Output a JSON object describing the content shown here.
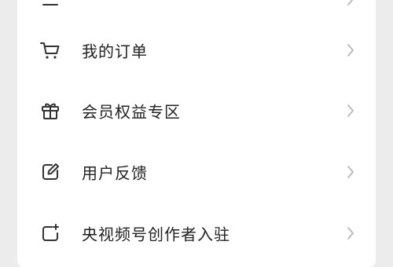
{
  "menu": {
    "items": [
      {
        "label": "",
        "icon": "partial-icon"
      },
      {
        "label": "我的订单",
        "icon": "cart-icon"
      },
      {
        "label": "会员权益专区",
        "icon": "gift-icon"
      },
      {
        "label": "用户反馈",
        "icon": "edit-icon"
      },
      {
        "label": "央视频号创作者入驻",
        "icon": "creator-icon"
      }
    ]
  },
  "colors": {
    "icon": "#333333",
    "text": "#222222",
    "chevron": "#b8b8b8",
    "card": "#ffffff",
    "background": "#ececec"
  }
}
